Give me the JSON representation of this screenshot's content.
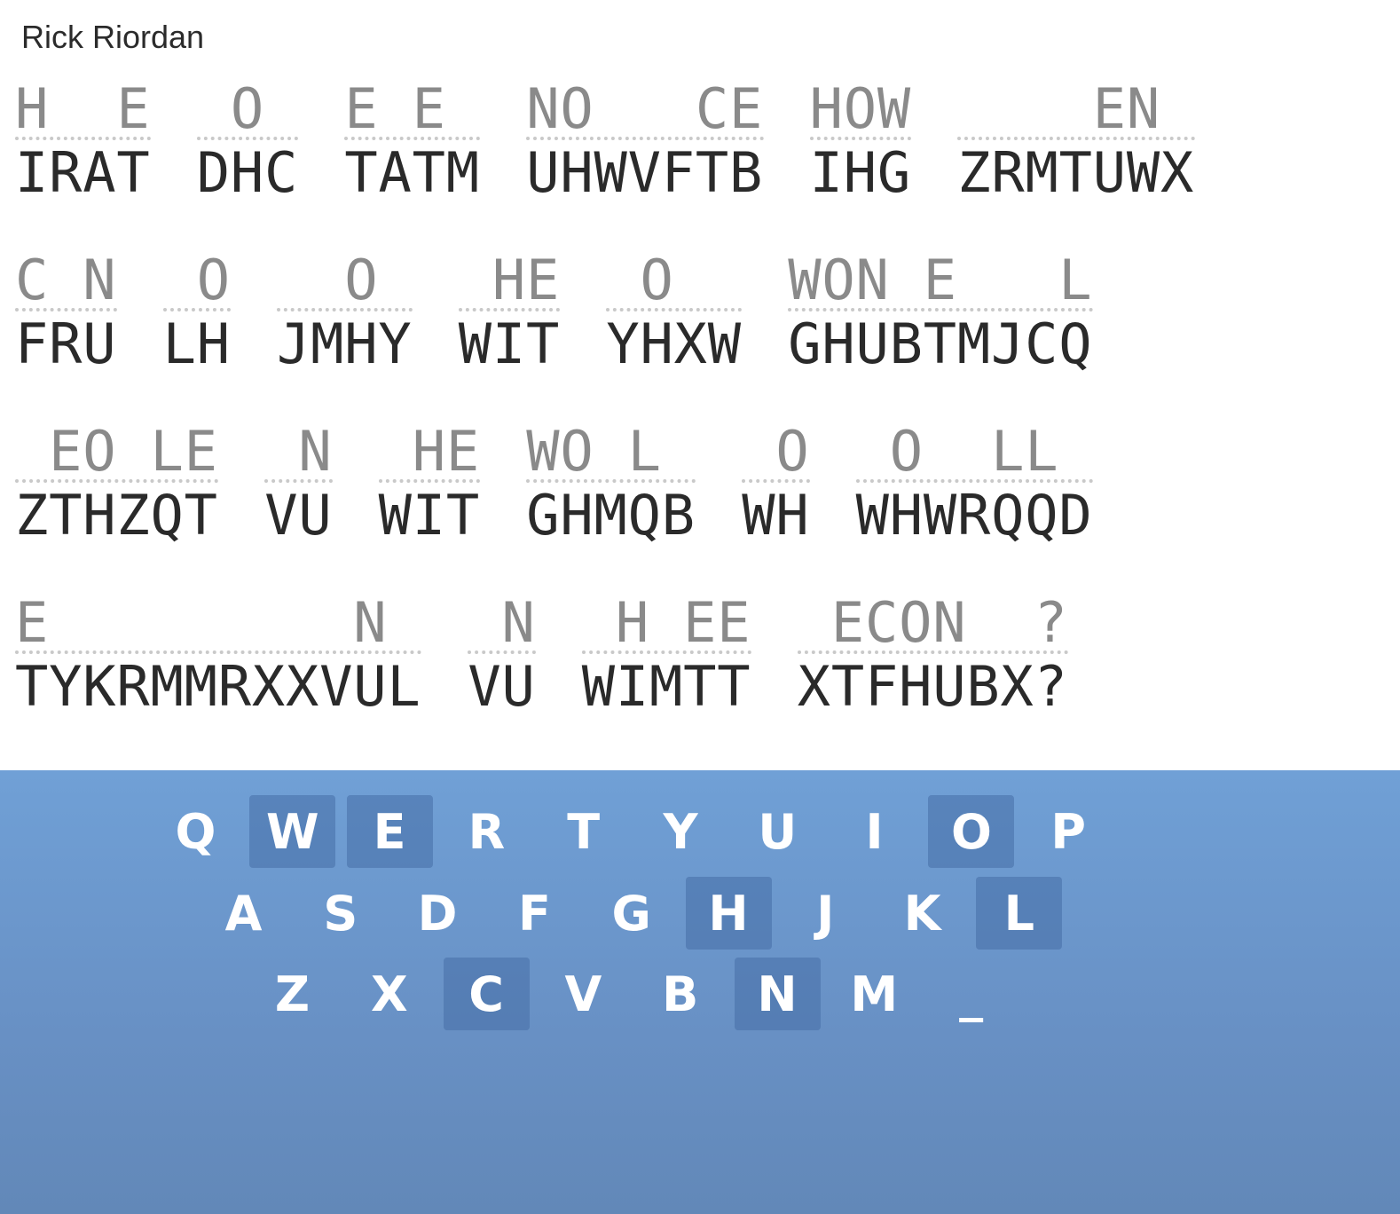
{
  "author": "Rick Riordan",
  "lines": [
    {
      "words": [
        {
          "guess": "H  E",
          "cipher": "IRAT"
        },
        {
          "guess": " O ",
          "cipher": "DHC"
        },
        {
          "guess": "E E",
          "cipher": "TATM"
        },
        {
          "guess": "NO   CE",
          "cipher": "UHWVFTB"
        },
        {
          "guess": "HOW",
          "cipher": "IHG"
        },
        {
          "guess": "    EN ",
          "cipher": "ZRMTUWX"
        }
      ]
    },
    {
      "words": [
        {
          "guess": "C N",
          "cipher": "FRU"
        },
        {
          "guess": " O",
          "cipher": "LH"
        },
        {
          "guess": "  O ",
          "cipher": "JMHY"
        },
        {
          "guess": " HE",
          "cipher": "WIT"
        },
        {
          "guess": " O  ",
          "cipher": "YHXW"
        },
        {
          "guess": "WON E   L",
          "cipher": "GHUBTMJCQ"
        }
      ]
    },
    {
      "words": [
        {
          "guess": " EO LE",
          "cipher": "ZTHZQT"
        },
        {
          "guess": " N",
          "cipher": "VU"
        },
        {
          "guess": " HE",
          "cipher": "WIT"
        },
        {
          "guess": "WO L ",
          "cipher": "GHMQB"
        },
        {
          "guess": " O",
          "cipher": "WH"
        },
        {
          "guess": " O  LL ",
          "cipher": "WHWRQQD"
        }
      ]
    },
    {
      "words": [
        {
          "guess": "E         N ",
          "cipher": "TYKRMMRXXVUL"
        },
        {
          "guess": " N",
          "cipher": "VU"
        },
        {
          "guess": " H EE",
          "cipher": "WIMTT"
        },
        {
          "guess": " ECON  ?",
          "cipher": "XTFHUBX?"
        }
      ]
    }
  ],
  "keyboard": {
    "rows": [
      [
        {
          "k": "Q",
          "used": false
        },
        {
          "k": "W",
          "used": true
        },
        {
          "k": "E",
          "used": true
        },
        {
          "k": "R",
          "used": false
        },
        {
          "k": "T",
          "used": false
        },
        {
          "k": "Y",
          "used": false
        },
        {
          "k": "U",
          "used": false
        },
        {
          "k": "I",
          "used": false
        },
        {
          "k": "O",
          "used": true
        },
        {
          "k": "P",
          "used": false
        }
      ],
      [
        {
          "k": "A",
          "used": false
        },
        {
          "k": "S",
          "used": false
        },
        {
          "k": "D",
          "used": false
        },
        {
          "k": "F",
          "used": false
        },
        {
          "k": "G",
          "used": false
        },
        {
          "k": "H",
          "used": true
        },
        {
          "k": "J",
          "used": false
        },
        {
          "k": "K",
          "used": false
        },
        {
          "k": "L",
          "used": true
        }
      ],
      [
        {
          "k": "Z",
          "used": false
        },
        {
          "k": "X",
          "used": false
        },
        {
          "k": "C",
          "used": true
        },
        {
          "k": "V",
          "used": false
        },
        {
          "k": "B",
          "used": false
        },
        {
          "k": "N",
          "used": true
        },
        {
          "k": "M",
          "used": false
        },
        {
          "k": "_",
          "used": false
        }
      ]
    ]
  }
}
